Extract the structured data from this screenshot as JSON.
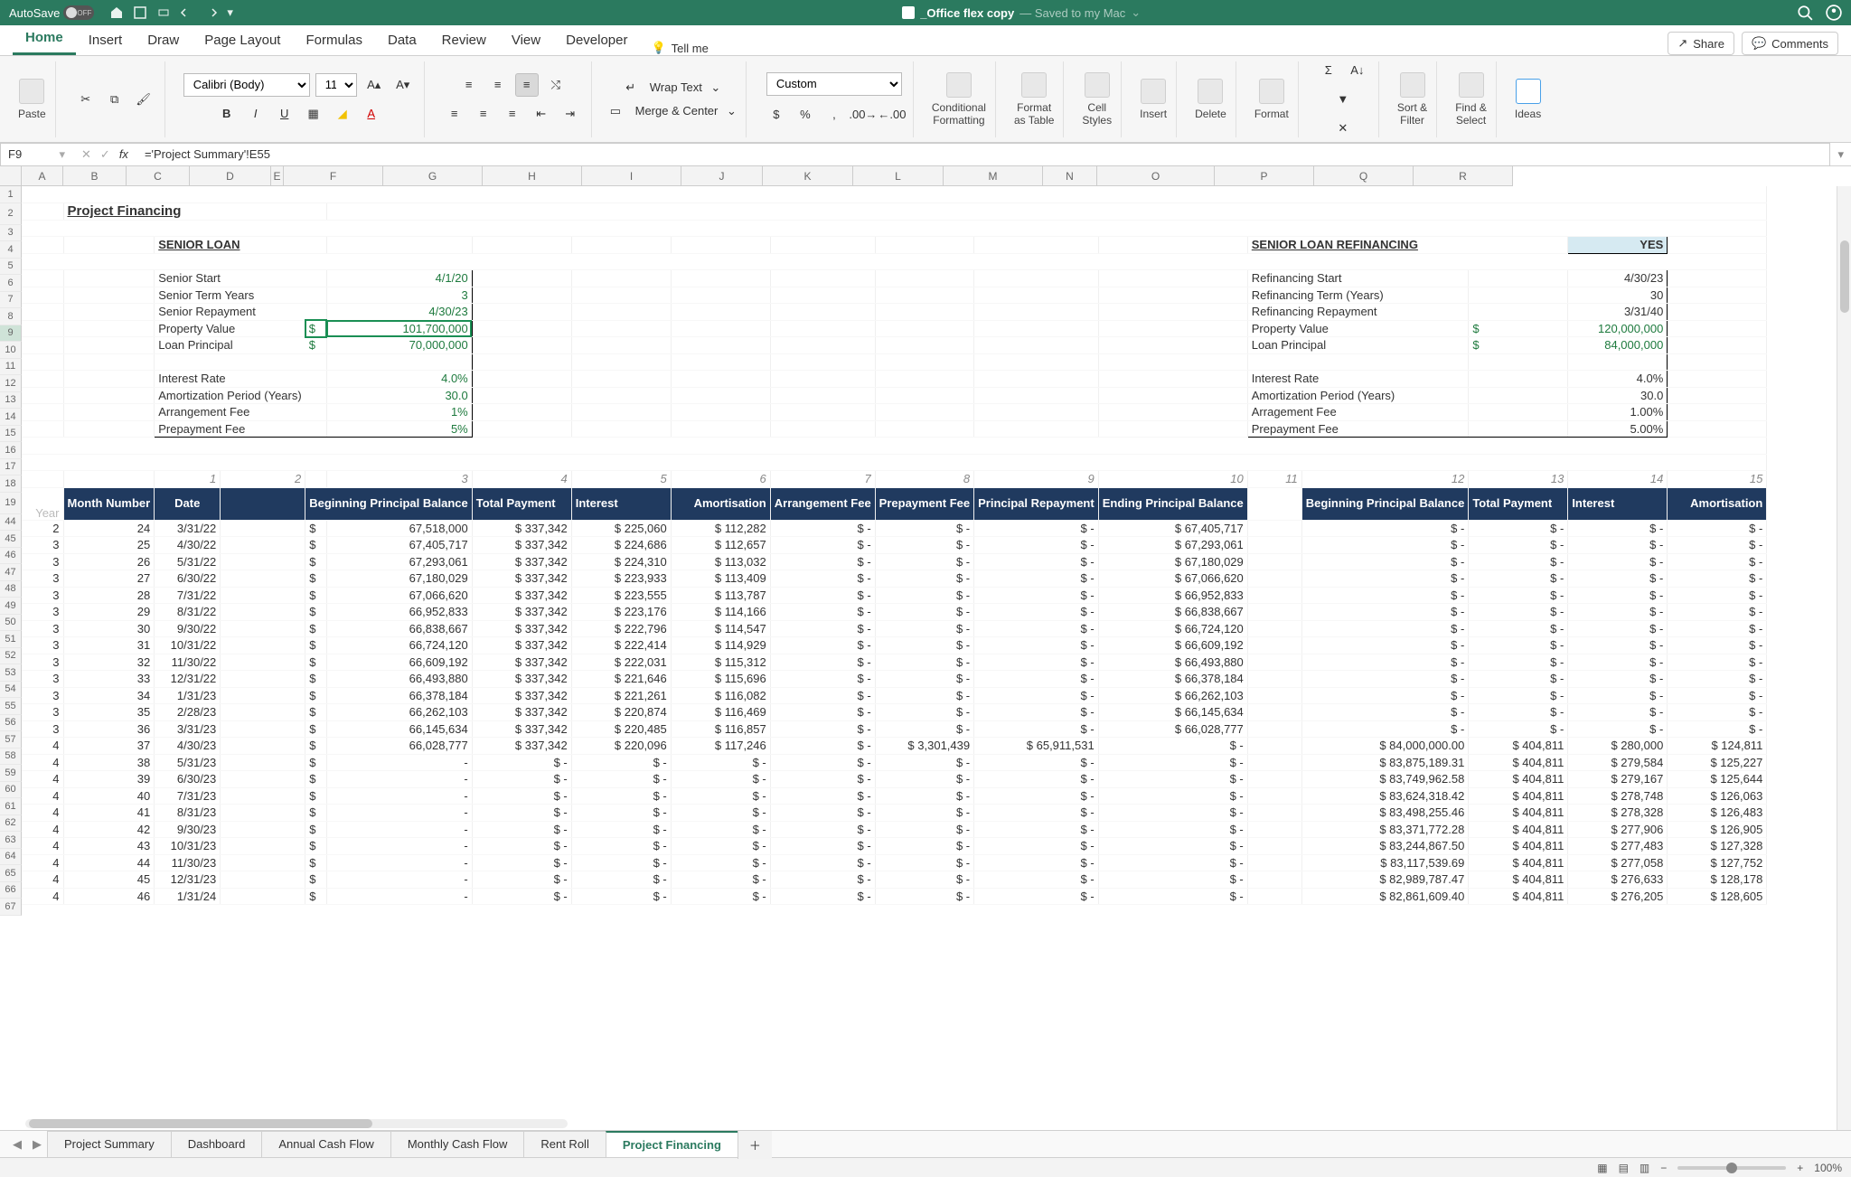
{
  "titlebar": {
    "autosave_label": "AutoSave",
    "autosave_state": "OFF",
    "filename": "_Office flex copy",
    "saved_hint": "— Saved to my Mac"
  },
  "tabs": {
    "items": [
      "Home",
      "Insert",
      "Draw",
      "Page Layout",
      "Formulas",
      "Data",
      "Review",
      "View",
      "Developer"
    ],
    "tellme_label": "Tell me",
    "share": "Share",
    "comments": "Comments",
    "active": "Home"
  },
  "ribbon": {
    "paste": "Paste",
    "font_name": "Calibri (Body)",
    "font_size": "11",
    "wrap_text": "Wrap Text",
    "merge_center": "Merge & Center",
    "number_format": "Custom",
    "cond_fmt": "Conditional\nFormatting",
    "fmt_table": "Format\nas Table",
    "cell_styles": "Cell\nStyles",
    "insert": "Insert",
    "delete": "Delete",
    "format": "Format",
    "sort_filter": "Sort &\nFilter",
    "find_select": "Find &\nSelect",
    "ideas": "Ideas"
  },
  "namebox": "F9",
  "formula": "='Project Summary'!E55",
  "columns": [
    "A",
    "B",
    "C",
    "D",
    "E",
    "F",
    "G",
    "H",
    "I",
    "J",
    "K",
    "L",
    "M",
    "N",
    "O",
    "P",
    "Q",
    "R"
  ],
  "top_rows": [
    1,
    2,
    3,
    4,
    5,
    6,
    7,
    8,
    9,
    10,
    11,
    12,
    13,
    14,
    15,
    16,
    17,
    18,
    19
  ],
  "bottom_rows": [
    44,
    45,
    46,
    47,
    48,
    49,
    50,
    51,
    52,
    53,
    54,
    55,
    56,
    57,
    58,
    59,
    60,
    61,
    62,
    63,
    64,
    65,
    66,
    67
  ],
  "doc": {
    "title": "Project Financing",
    "senior_heading": "SENIOR LOAN",
    "refi_heading": "SENIOR LOAN REFINANCING",
    "refi_flag": "YES",
    "senior": [
      {
        "label": "Senior Start",
        "val": "4/1/20"
      },
      {
        "label": "Senior Term Years",
        "val": "3"
      },
      {
        "label": "Senior Repayment",
        "val": "4/30/23"
      },
      {
        "label": "Property Value",
        "val": "101,700,000",
        "dollar": true,
        "selected": true
      },
      {
        "label": "Loan Principal",
        "val": "70,000,000",
        "dollar": true
      },
      {
        "label": "",
        "val": ""
      },
      {
        "label": "Interest Rate",
        "val": "4.0%"
      },
      {
        "label": "Amortization Period (Years)",
        "val": "30.0"
      },
      {
        "label": "Arrangement Fee",
        "val": "1%"
      },
      {
        "label": "Prepayment Fee",
        "val": "5%"
      }
    ],
    "refi": [
      {
        "label": "Refinancing Start",
        "val": "4/30/23"
      },
      {
        "label": "Refinancing Term (Years)",
        "val": "30"
      },
      {
        "label": "Refinancing Repayment",
        "val": "3/31/40"
      },
      {
        "label": "Property Value",
        "val": "120,000,000",
        "dollar": true
      },
      {
        "label": "Loan Principal",
        "val": "84,000,000",
        "dollar": true
      },
      {
        "label": "",
        "val": ""
      },
      {
        "label": "Interest Rate",
        "val": "4.0%"
      },
      {
        "label": "Amortization Period (Years)",
        "val": "30.0"
      },
      {
        "label": "Arragement Fee",
        "val": "1.00%"
      },
      {
        "label": "Prepayment Fee",
        "val": "5.00%"
      }
    ],
    "periods": [
      "1",
      "2",
      "3",
      "4",
      "5",
      "6",
      "7",
      "8",
      "9",
      "10",
      "11",
      "12",
      "13",
      "14",
      "15"
    ],
    "table_headers_left": {
      "year": "Year",
      "month": "Month\nNumber",
      "date": "Date",
      "beg": "Beginning Principal Balance",
      "tot": "Total Payment",
      "int": "Interest",
      "amort": "Amortisation",
      "arr": "Arrangement Fee",
      "prep": "Prepayment Fee",
      "princ": "Principal Repayment",
      "end": "Ending Principal Balance"
    },
    "table_headers_right": {
      "beg": "Beginning Principal Balance",
      "tot": "Total Payment",
      "int": "Interest",
      "amort": "Amortisation"
    },
    "rows": [
      {
        "yr": 2,
        "mn": 24,
        "date": "3/31/22",
        "beg": "67,518,000",
        "tot": "337,342",
        "int": "225,060",
        "am": "112,282",
        "ar": "-",
        "pp": "-",
        "pr": "-",
        "end": "67,405,717",
        "rbeg": "-",
        "rtot": "-",
        "rint": "-",
        "ram": "-"
      },
      {
        "yr": 3,
        "mn": 25,
        "date": "4/30/22",
        "beg": "67,405,717",
        "tot": "337,342",
        "int": "224,686",
        "am": "112,657",
        "ar": "-",
        "pp": "-",
        "pr": "-",
        "end": "67,293,061",
        "rbeg": "-",
        "rtot": "-",
        "rint": "-",
        "ram": "-"
      },
      {
        "yr": 3,
        "mn": 26,
        "date": "5/31/22",
        "beg": "67,293,061",
        "tot": "337,342",
        "int": "224,310",
        "am": "113,032",
        "ar": "-",
        "pp": "-",
        "pr": "-",
        "end": "67,180,029",
        "rbeg": "-",
        "rtot": "-",
        "rint": "-",
        "ram": "-"
      },
      {
        "yr": 3,
        "mn": 27,
        "date": "6/30/22",
        "beg": "67,180,029",
        "tot": "337,342",
        "int": "223,933",
        "am": "113,409",
        "ar": "-",
        "pp": "-",
        "pr": "-",
        "end": "67,066,620",
        "rbeg": "-",
        "rtot": "-",
        "rint": "-",
        "ram": "-"
      },
      {
        "yr": 3,
        "mn": 28,
        "date": "7/31/22",
        "beg": "67,066,620",
        "tot": "337,342",
        "int": "223,555",
        "am": "113,787",
        "ar": "-",
        "pp": "-",
        "pr": "-",
        "end": "66,952,833",
        "rbeg": "-",
        "rtot": "-",
        "rint": "-",
        "ram": "-"
      },
      {
        "yr": 3,
        "mn": 29,
        "date": "8/31/22",
        "beg": "66,952,833",
        "tot": "337,342",
        "int": "223,176",
        "am": "114,166",
        "ar": "-",
        "pp": "-",
        "pr": "-",
        "end": "66,838,667",
        "rbeg": "-",
        "rtot": "-",
        "rint": "-",
        "ram": "-"
      },
      {
        "yr": 3,
        "mn": 30,
        "date": "9/30/22",
        "beg": "66,838,667",
        "tot": "337,342",
        "int": "222,796",
        "am": "114,547",
        "ar": "-",
        "pp": "-",
        "pr": "-",
        "end": "66,724,120",
        "rbeg": "-",
        "rtot": "-",
        "rint": "-",
        "ram": "-"
      },
      {
        "yr": 3,
        "mn": 31,
        "date": "10/31/22",
        "beg": "66,724,120",
        "tot": "337,342",
        "int": "222,414",
        "am": "114,929",
        "ar": "-",
        "pp": "-",
        "pr": "-",
        "end": "66,609,192",
        "rbeg": "-",
        "rtot": "-",
        "rint": "-",
        "ram": "-"
      },
      {
        "yr": 3,
        "mn": 32,
        "date": "11/30/22",
        "beg": "66,609,192",
        "tot": "337,342",
        "int": "222,031",
        "am": "115,312",
        "ar": "-",
        "pp": "-",
        "pr": "-",
        "end": "66,493,880",
        "rbeg": "-",
        "rtot": "-",
        "rint": "-",
        "ram": "-"
      },
      {
        "yr": 3,
        "mn": 33,
        "date": "12/31/22",
        "beg": "66,493,880",
        "tot": "337,342",
        "int": "221,646",
        "am": "115,696",
        "ar": "-",
        "pp": "-",
        "pr": "-",
        "end": "66,378,184",
        "rbeg": "-",
        "rtot": "-",
        "rint": "-",
        "ram": "-"
      },
      {
        "yr": 3,
        "mn": 34,
        "date": "1/31/23",
        "beg": "66,378,184",
        "tot": "337,342",
        "int": "221,261",
        "am": "116,082",
        "ar": "-",
        "pp": "-",
        "pr": "-",
        "end": "66,262,103",
        "rbeg": "-",
        "rtot": "-",
        "rint": "-",
        "ram": "-"
      },
      {
        "yr": 3,
        "mn": 35,
        "date": "2/28/23",
        "beg": "66,262,103",
        "tot": "337,342",
        "int": "220,874",
        "am": "116,469",
        "ar": "-",
        "pp": "-",
        "pr": "-",
        "end": "66,145,634",
        "rbeg": "-",
        "rtot": "-",
        "rint": "-",
        "ram": "-"
      },
      {
        "yr": 3,
        "mn": 36,
        "date": "3/31/23",
        "beg": "66,145,634",
        "tot": "337,342",
        "int": "220,485",
        "am": "116,857",
        "ar": "-",
        "pp": "-",
        "pr": "-",
        "end": "66,028,777",
        "rbeg": "-",
        "rtot": "-",
        "rint": "-",
        "ram": "-"
      },
      {
        "yr": 4,
        "mn": 37,
        "date": "4/30/23",
        "beg": "66,028,777",
        "tot": "337,342",
        "int": "220,096",
        "am": "117,246",
        "ar": "-",
        "pp": "3,301,439",
        "pr": "65,911,531",
        "end": "-",
        "rbeg": "84,000,000.00",
        "rtot": "404,811",
        "rint": "280,000",
        "ram": "124,811"
      },
      {
        "yr": 4,
        "mn": 38,
        "date": "5/31/23",
        "beg": "-",
        "tot": "-",
        "int": "-",
        "am": "-",
        "ar": "-",
        "pp": "-",
        "pr": "-",
        "end": "-",
        "rbeg": "83,875,189.31",
        "rtot": "404,811",
        "rint": "279,584",
        "ram": "125,227"
      },
      {
        "yr": 4,
        "mn": 39,
        "date": "6/30/23",
        "beg": "-",
        "tot": "-",
        "int": "-",
        "am": "-",
        "ar": "-",
        "pp": "-",
        "pr": "-",
        "end": "-",
        "rbeg": "83,749,962.58",
        "rtot": "404,811",
        "rint": "279,167",
        "ram": "125,644"
      },
      {
        "yr": 4,
        "mn": 40,
        "date": "7/31/23",
        "beg": "-",
        "tot": "-",
        "int": "-",
        "am": "-",
        "ar": "-",
        "pp": "-",
        "pr": "-",
        "end": "-",
        "rbeg": "83,624,318.42",
        "rtot": "404,811",
        "rint": "278,748",
        "ram": "126,063"
      },
      {
        "yr": 4,
        "mn": 41,
        "date": "8/31/23",
        "beg": "-",
        "tot": "-",
        "int": "-",
        "am": "-",
        "ar": "-",
        "pp": "-",
        "pr": "-",
        "end": "-",
        "rbeg": "83,498,255.46",
        "rtot": "404,811",
        "rint": "278,328",
        "ram": "126,483"
      },
      {
        "yr": 4,
        "mn": 42,
        "date": "9/30/23",
        "beg": "-",
        "tot": "-",
        "int": "-",
        "am": "-",
        "ar": "-",
        "pp": "-",
        "pr": "-",
        "end": "-",
        "rbeg": "83,371,772.28",
        "rtot": "404,811",
        "rint": "277,906",
        "ram": "126,905"
      },
      {
        "yr": 4,
        "mn": 43,
        "date": "10/31/23",
        "beg": "-",
        "tot": "-",
        "int": "-",
        "am": "-",
        "ar": "-",
        "pp": "-",
        "pr": "-",
        "end": "-",
        "rbeg": "83,244,867.50",
        "rtot": "404,811",
        "rint": "277,483",
        "ram": "127,328"
      },
      {
        "yr": 4,
        "mn": 44,
        "date": "11/30/23",
        "beg": "-",
        "tot": "-",
        "int": "-",
        "am": "-",
        "ar": "-",
        "pp": "-",
        "pr": "-",
        "end": "-",
        "rbeg": "83,117,539.69",
        "rtot": "404,811",
        "rint": "277,058",
        "ram": "127,752"
      },
      {
        "yr": 4,
        "mn": 45,
        "date": "12/31/23",
        "beg": "-",
        "tot": "-",
        "int": "-",
        "am": "-",
        "ar": "-",
        "pp": "-",
        "pr": "-",
        "end": "-",
        "rbeg": "82,989,787.47",
        "rtot": "404,811",
        "rint": "276,633",
        "ram": "128,178"
      },
      {
        "yr": 4,
        "mn": 46,
        "date": "1/31/24",
        "beg": "-",
        "tot": "-",
        "int": "-",
        "am": "-",
        "ar": "-",
        "pp": "-",
        "pr": "-",
        "end": "-",
        "rbeg": "82,861,609.40",
        "rtot": "404,811",
        "rint": "276,205",
        "ram": "128,605"
      }
    ]
  },
  "sheets": [
    "Project Summary",
    "Dashboard",
    "Annual Cash Flow",
    "Monthly Cash Flow",
    "Rent Roll",
    "Project Financing"
  ],
  "active_sheet": "Project Financing",
  "statusbar": {
    "zoom": "100%"
  }
}
